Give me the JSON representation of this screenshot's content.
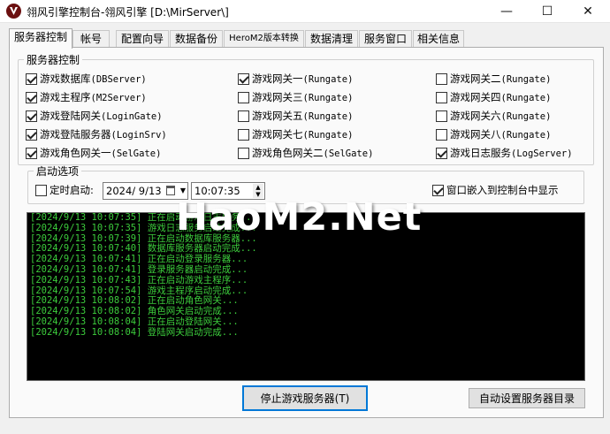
{
  "window": {
    "title": "翎风引擎控制台-翎风引擎 [D:\\MirServer\\]",
    "minimize_glyph": "—",
    "maximize_glyph": "☐",
    "close_glyph": "✕",
    "icon": "app-logo-icon"
  },
  "tabs": [
    {
      "label": "服务器控制",
      "active": true
    },
    {
      "label": "帐号"
    },
    {
      "label": "配置向导"
    },
    {
      "label": "数据备份"
    },
    {
      "label": "HeroM2版本转换"
    },
    {
      "label": "数据清理"
    },
    {
      "label": "服务窗口"
    },
    {
      "label": "相关信息"
    }
  ],
  "server_control": {
    "legend": "服务器控制",
    "items": [
      {
        "name": "游戏数据库",
        "code": "(DBServer)",
        "checked": true
      },
      {
        "name": "游戏主程序",
        "code": "(M2Server)",
        "checked": true
      },
      {
        "name": "游戏登陆网关",
        "code": "(LoginGate)",
        "checked": true
      },
      {
        "name": "游戏登陆服务器",
        "code": "(LoginSrv)",
        "checked": true
      },
      {
        "name": "游戏角色网关一",
        "code": "(SelGate)",
        "checked": true
      },
      {
        "name": "游戏网关一",
        "code": "(Rungate)",
        "checked": true
      },
      {
        "name": "游戏网关三",
        "code": "(Rungate)",
        "checked": false
      },
      {
        "name": "游戏网关五",
        "code": "(Rungate)",
        "checked": false
      },
      {
        "name": "游戏网关七",
        "code": "(Rungate)",
        "checked": false
      },
      {
        "name": "游戏角色网关二",
        "code": "(SelGate)",
        "checked": false
      },
      {
        "name": "游戏网关二",
        "code": "(Rungate)",
        "checked": false
      },
      {
        "name": "游戏网关四",
        "code": "(Rungate)",
        "checked": false
      },
      {
        "name": "游戏网关六",
        "code": "(Rungate)",
        "checked": false
      },
      {
        "name": "游戏网关八",
        "code": "(Rungate)",
        "checked": false
      },
      {
        "name": "游戏日志服务",
        "code": "(LogServer)",
        "checked": true
      }
    ]
  },
  "startup": {
    "legend": "启动选项",
    "timed_start_label": "定时启动:",
    "timed_start_checked": false,
    "date_value": "2024/ 9/13",
    "time_value": "10:07:35",
    "embed_label": "窗口嵌入到控制台中显示",
    "embed_checked": true
  },
  "log": {
    "lines": [
      "[2024/9/13 10:07:35] 正在启动游戏日志服务...",
      "[2024/9/13 10:07:35] 游戏日志服务启动完成...",
      "[2024/9/13 10:07:39] 正在启动数据库服务器...",
      "[2024/9/13 10:07:40] 数据库服务器启动完成...",
      "[2024/9/13 10:07:41] 正在启动登录服务器...",
      "[2024/9/13 10:07:41] 登录服务器启动完成...",
      "[2024/9/13 10:07:43] 正在启动游戏主程序...",
      "[2024/9/13 10:07:54] 游戏主程序启动完成...",
      "[2024/9/13 10:08:02] 正在启动角色网关...",
      "[2024/9/13 10:08:02] 角色网关启动完成...",
      "[2024/9/13 10:08:04] 正在启动登陆网关...",
      "[2024/9/13 10:08:04] 登陆网关启动完成..."
    ],
    "text_color": "#3ccc3c",
    "background": "#000000"
  },
  "buttons": {
    "stop_server": "停止游戏服务器(T)",
    "auto_set_dir": "自动设置服务器目录"
  },
  "watermark": "HaoM2.Net",
  "accent_color": "#0078d7"
}
